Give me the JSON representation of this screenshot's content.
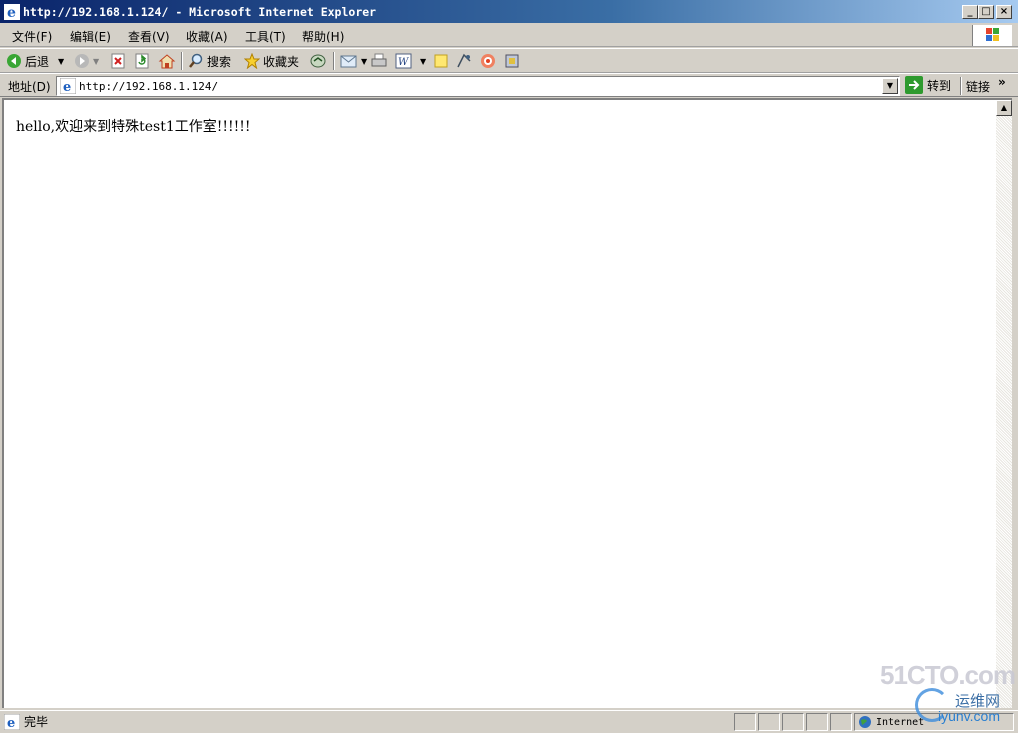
{
  "window": {
    "title": "http://192.168.1.124/ - Microsoft Internet Explorer"
  },
  "menu": {
    "items": [
      "文件(F)",
      "编辑(E)",
      "查看(V)",
      "收藏(A)",
      "工具(T)",
      "帮助(H)"
    ]
  },
  "toolbar": {
    "back_label": "后退",
    "search_label": "搜索",
    "favorites_label": "收藏夹"
  },
  "address": {
    "label": "地址(D)",
    "value": "http://192.168.1.124/",
    "go_label": "转到",
    "links_label": "链接"
  },
  "page": {
    "text": "hello,欢迎来到特殊test1工作室!!!!!!"
  },
  "status": {
    "text": "完毕",
    "zone": "Internet"
  },
  "watermark": {
    "line1": "51CTO.com",
    "line2": "运维网",
    "line3": "iyunv.com"
  },
  "colors": {
    "titlebar": "#0a246a",
    "chrome": "#d4d0c8"
  }
}
